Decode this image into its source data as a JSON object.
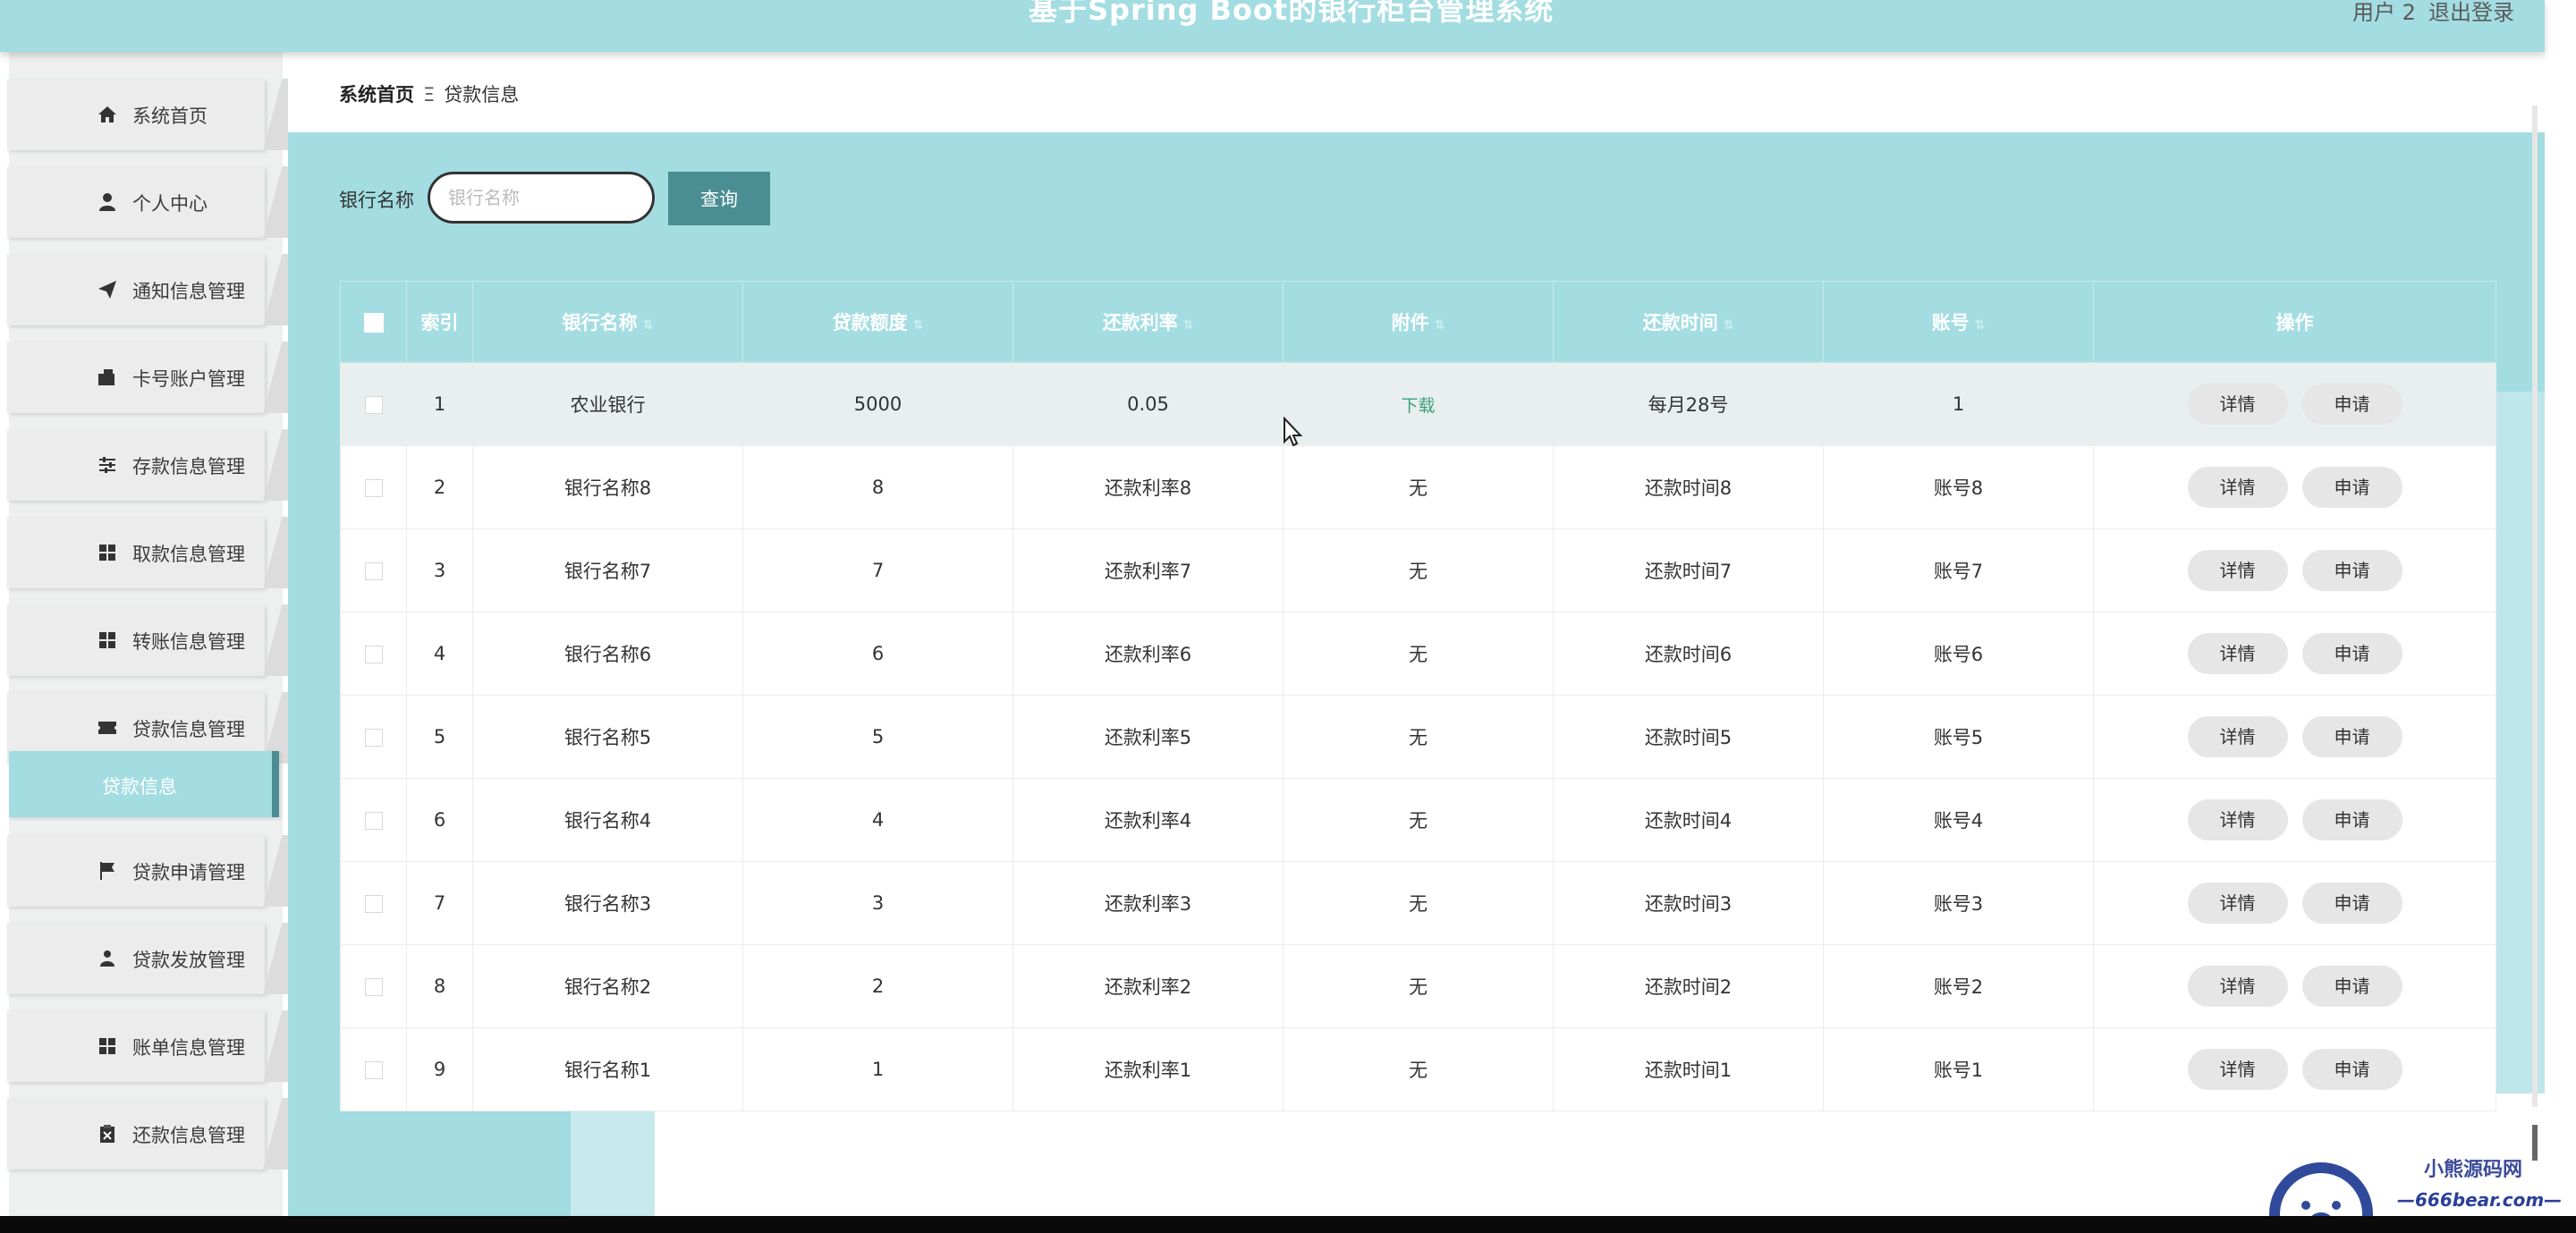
{
  "header": {
    "title": "基于Spring Boot的银行柜台管理系统",
    "user_label": "用户 2",
    "logout_label": "退出登录"
  },
  "sidebar": {
    "items": [
      {
        "label": "系统首页",
        "icon": "home-icon"
      },
      {
        "label": "个人中心",
        "icon": "user-icon"
      },
      {
        "label": "通知信息管理",
        "icon": "send-icon"
      },
      {
        "label": "卡号账户管理",
        "icon": "card-icon"
      },
      {
        "label": "存款信息管理",
        "icon": "sliders-icon"
      },
      {
        "label": "取款信息管理",
        "icon": "grid-icon"
      },
      {
        "label": "转账信息管理",
        "icon": "grid-icon"
      },
      {
        "label": "贷款信息管理",
        "icon": "ticket-icon"
      },
      {
        "label": "贷款申请管理",
        "icon": "flag-icon"
      },
      {
        "label": "贷款发放管理",
        "icon": "person-icon"
      },
      {
        "label": "账单信息管理",
        "icon": "grid-icon"
      },
      {
        "label": "还款信息管理",
        "icon": "clipboard-icon"
      }
    ],
    "active_sub": "贷款信息"
  },
  "breadcrumb": {
    "home": "系统首页",
    "separator": "Ξ",
    "current": "贷款信息"
  },
  "search": {
    "label": "银行名称",
    "placeholder": "银行名称",
    "value": "",
    "button": "查询"
  },
  "table": {
    "headers": [
      "索引",
      "银行名称",
      "贷款额度",
      "还款利率",
      "附件",
      "还款时间",
      "账号",
      "操作"
    ],
    "rows": [
      {
        "index": "1",
        "bank": "农业银行",
        "amount": "5000",
        "rate": "0.05",
        "attachment": "下载",
        "time": "每月28号",
        "account": "1"
      },
      {
        "index": "2",
        "bank": "银行名称8",
        "amount": "8",
        "rate": "还款利率8",
        "attachment": "无",
        "time": "还款时间8",
        "account": "账号8"
      },
      {
        "index": "3",
        "bank": "银行名称7",
        "amount": "7",
        "rate": "还款利率7",
        "attachment": "无",
        "time": "还款时间7",
        "account": "账号7"
      },
      {
        "index": "4",
        "bank": "银行名称6",
        "amount": "6",
        "rate": "还款利率6",
        "attachment": "无",
        "time": "还款时间6",
        "account": "账号6"
      },
      {
        "index": "5",
        "bank": "银行名称5",
        "amount": "5",
        "rate": "还款利率5",
        "attachment": "无",
        "time": "还款时间5",
        "account": "账号5"
      },
      {
        "index": "6",
        "bank": "银行名称4",
        "amount": "4",
        "rate": "还款利率4",
        "attachment": "无",
        "time": "还款时间4",
        "account": "账号4"
      },
      {
        "index": "7",
        "bank": "银行名称3",
        "amount": "3",
        "rate": "还款利率3",
        "attachment": "无",
        "time": "还款时间3",
        "account": "账号3"
      },
      {
        "index": "8",
        "bank": "银行名称2",
        "amount": "2",
        "rate": "还款利率2",
        "attachment": "无",
        "time": "还款时间2",
        "account": "账号2"
      },
      {
        "index": "9",
        "bank": "银行名称1",
        "amount": "1",
        "rate": "还款利率1",
        "attachment": "无",
        "time": "还款时间1",
        "account": "账号1"
      }
    ],
    "detail_label": "详情",
    "apply_label": "申请"
  },
  "watermark": {
    "line1": "小熊源码网",
    "line2": "—666bear.com—"
  },
  "colors": {
    "teal_light": "#a3dde2",
    "teal_dark": "#4a8d92",
    "download_link": "#3aa17a"
  }
}
